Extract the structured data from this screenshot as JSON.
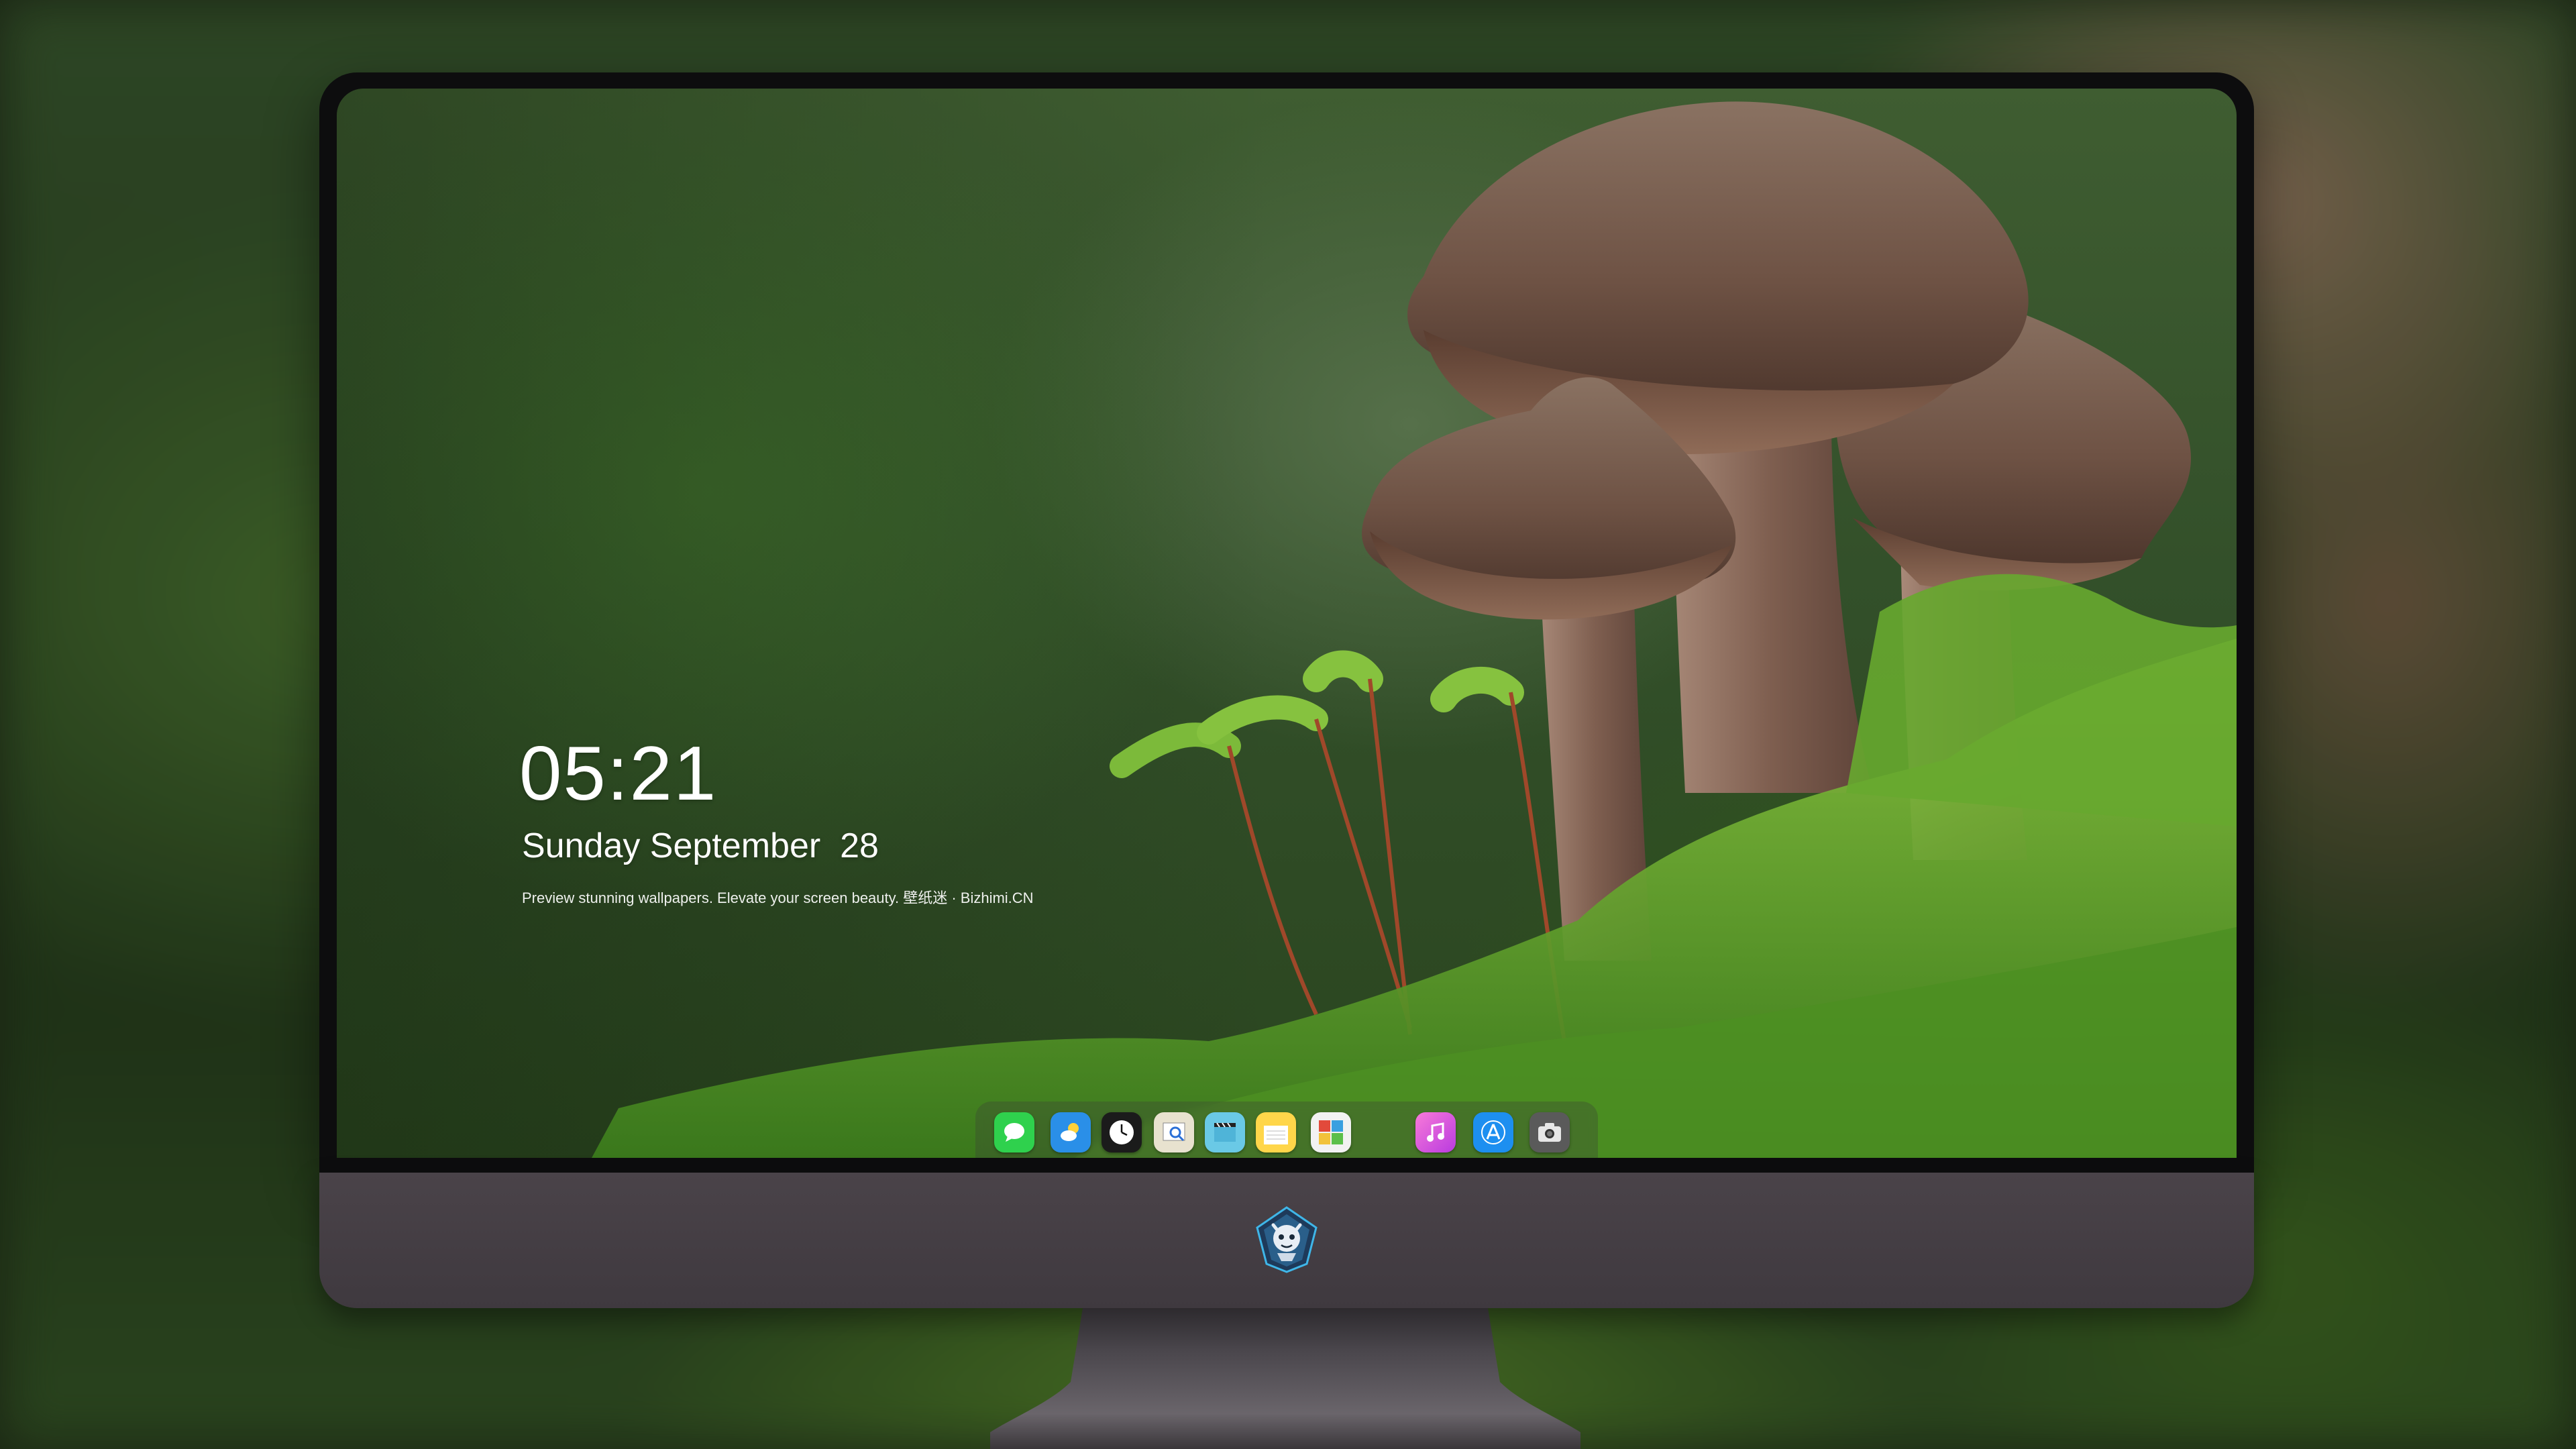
{
  "lockscreen": {
    "time": "05:21",
    "date": "Sunday September  28",
    "tagline": "Preview stunning wallpapers. Elevate your screen beauty. 壁纸迷 · Bizhimi.CN"
  },
  "dock": {
    "apps": [
      {
        "name": "Messages",
        "icon": "messages-icon",
        "color": "#2fd14d"
      },
      {
        "name": "Weather",
        "icon": "weather-icon",
        "color": "#2a8fe8"
      },
      {
        "name": "Clock",
        "icon": "clock-icon",
        "color": "#1b1b1b"
      },
      {
        "name": "Preview",
        "icon": "preview-icon",
        "color": "#e8e2cf"
      },
      {
        "name": "Clips",
        "icon": "clips-icon",
        "color": "#6ac9e6"
      },
      {
        "name": "Notes",
        "icon": "notes-icon",
        "color": "#ffd64a"
      },
      {
        "name": "Photo Booth",
        "icon": "photobooth-icon",
        "color": "#f2f2f2"
      },
      {
        "name": "Music",
        "icon": "music-icon",
        "color": "#e64fc4"
      },
      {
        "name": "App Store",
        "icon": "appstore-icon",
        "color": "#1d8ff0"
      },
      {
        "name": "Camera",
        "icon": "camera-icon",
        "color": "#5a5a5a"
      }
    ]
  },
  "monitor": {
    "logo_icon": "dragon-mascot-icon",
    "chin_color": "#433d43",
    "bezel_color": "#0d0d0e"
  }
}
